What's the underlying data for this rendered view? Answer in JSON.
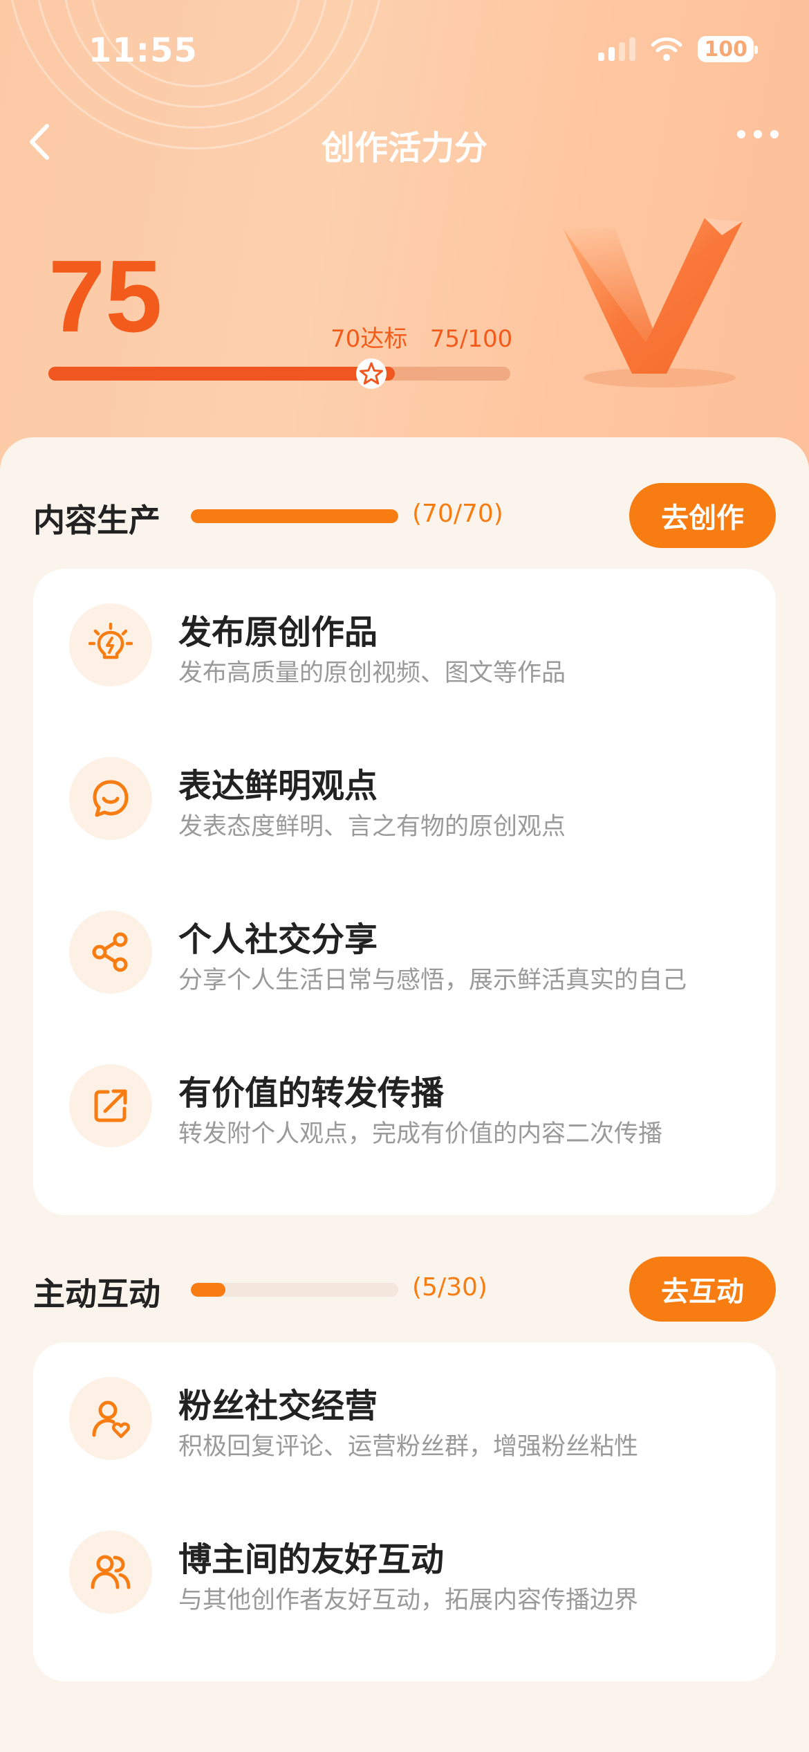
{
  "status_bar": {
    "time": "11:55",
    "battery": "100"
  },
  "header": {
    "title": "创作活力分"
  },
  "score": {
    "value": "75",
    "threshold_label": "70达标",
    "ratio_label": "75/100",
    "progress": 0.75
  },
  "sections": [
    {
      "title": "内容生产",
      "count": "(70/70)",
      "progress": 1.0,
      "button": "去创作",
      "items": [
        {
          "title": "发布原创作品",
          "desc": "发布高质量的原创视频、图文等作品",
          "icon": "lightbulb-icon"
        },
        {
          "title": "表达鲜明观点",
          "desc": "发表态度鲜明、言之有物的原创观点",
          "icon": "chat-smile-icon"
        },
        {
          "title": "个人社交分享",
          "desc": "分享个人生活日常与感悟，展示鲜活真实的自己",
          "icon": "share-icon"
        },
        {
          "title": "有价值的转发传播",
          "desc": "转发附个人观点，完成有价值的内容二次传播",
          "icon": "forward-icon"
        }
      ]
    },
    {
      "title": "主动互动",
      "count": "(5/30)",
      "progress": 0.1667,
      "button": "去互动",
      "items": [
        {
          "title": "粉丝社交经营",
          "desc": "积极回复评论、运营粉丝群，增强粉丝粘性",
          "icon": "user-heart-icon"
        },
        {
          "title": "博主间的友好互动",
          "desc": "与其他创作者友好互动，拓展内容传播边界",
          "icon": "users-icon"
        }
      ]
    }
  ],
  "colors": {
    "accent": "#f77d12",
    "score": "#f25b1b",
    "hero": "#fdc9a4"
  }
}
